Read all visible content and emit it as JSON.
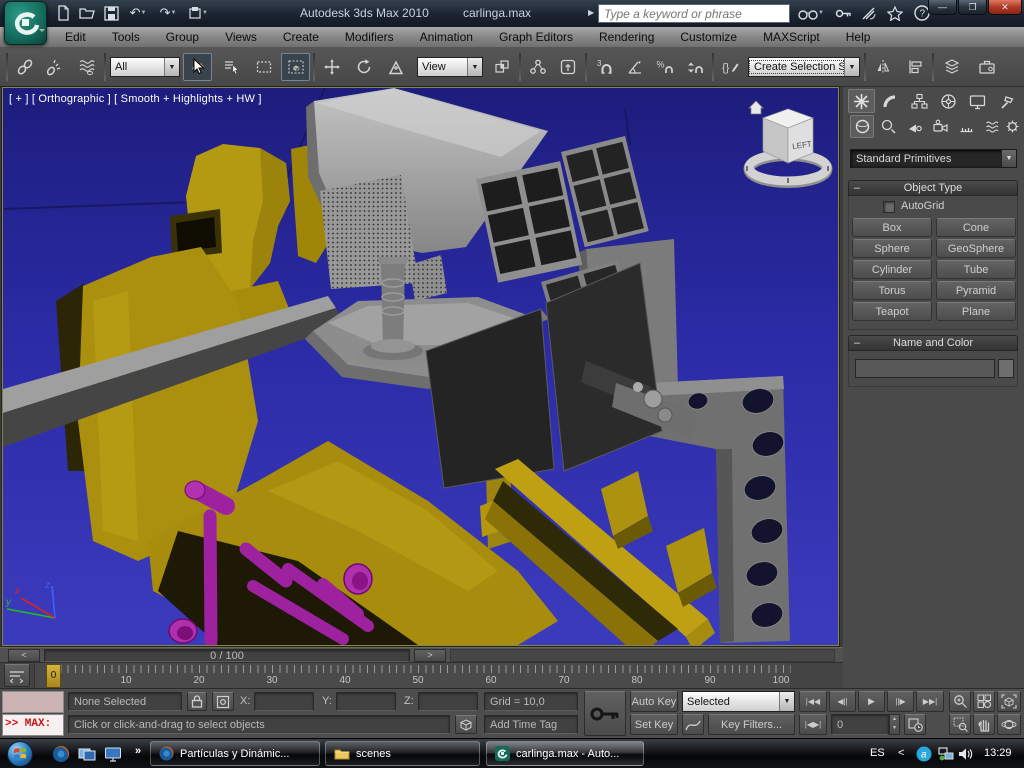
{
  "colors": {
    "viewport_blue": "#2d2da8",
    "model_yellow": "#b2960f",
    "model_magenta": "#a124a0",
    "model_gray": "#9a9a9a",
    "active_viewport_border": "#85854e",
    "close_button_red": "#b03a24"
  },
  "title_bar": {
    "app_title": "Autodesk 3ds Max 2010",
    "document": "carlinga.max",
    "search_placeholder": "Type a keyword or phrase"
  },
  "menu_bar": {
    "items": [
      "Edit",
      "Tools",
      "Group",
      "Views",
      "Create",
      "Modifiers",
      "Animation",
      "Graph Editors",
      "Rendering",
      "Customize",
      "MAXScript",
      "Help"
    ]
  },
  "toolbar": {
    "selection_filter": "All",
    "reference_coordinate": "View",
    "named_selection_set": "Create Selection Se",
    "icon_names": [
      "link",
      "unlink",
      "bind-to-space-warp",
      "select-object",
      "select-by-name",
      "rectangular-selection-region",
      "window-crossing",
      "select-and-move",
      "select-and-rotate",
      "select-and-scale",
      "use-center",
      "select-and-manipulate",
      "keyboard-override",
      "snaps-toggle",
      "angle-snap",
      "percent-snap",
      "spinner-snap",
      "edit-named-selection-sets",
      "mirror",
      "align",
      "layer-manager",
      "toolbox"
    ]
  },
  "viewport": {
    "label": "[ + ] [ Orthographic ] [ Smooth + Highlights + HW ]",
    "viewcube_face": "LEFT",
    "axis_x": "x",
    "axis_y": "y",
    "axis_z": "z"
  },
  "command_panel": {
    "category": "Standard Primitives",
    "object_type": {
      "title": "Object Type",
      "autogrid": "AutoGrid",
      "buttons": [
        "Box",
        "Cone",
        "Sphere",
        "GeoSphere",
        "Cylinder",
        "Tube",
        "Torus",
        "Pyramid",
        "Teapot",
        "Plane"
      ]
    },
    "name_and_color": {
      "title": "Name and Color",
      "name_value": ""
    }
  },
  "timeline": {
    "time_display": "0 / 100",
    "current_frame": "0",
    "ruler_numbers": [
      "10",
      "20",
      "30",
      "40",
      "50",
      "60",
      "70",
      "80",
      "90",
      "100"
    ]
  },
  "status_bar": {
    "maxscript_prompt": ">> MAX:",
    "selection_status": "None Selected",
    "x_label": "X:",
    "y_label": "Y:",
    "z_label": "Z:",
    "x_value": "",
    "y_value": "",
    "z_value": "",
    "grid": "Grid = 10,0",
    "prompt": "Click or click-and-drag to select objects",
    "add_time_tag": "Add Time Tag",
    "auto_key": "Auto Key",
    "set_key": "Set Key",
    "key_filter_dropdown": "Selected",
    "key_filters": "Key Filters...",
    "frame_number": "0"
  },
  "taskbar": {
    "quick_launch_icons": [
      "firefox",
      "window-switcher",
      "show-desktop"
    ],
    "tasks": [
      {
        "label": "Partículas y Dinámic...",
        "icon": "firefox"
      },
      {
        "label": "scenes",
        "icon": "folder"
      },
      {
        "label": "carlinga.max - Auto...",
        "icon": "3dsmax"
      }
    ],
    "language": "ES",
    "time": "13:29"
  }
}
